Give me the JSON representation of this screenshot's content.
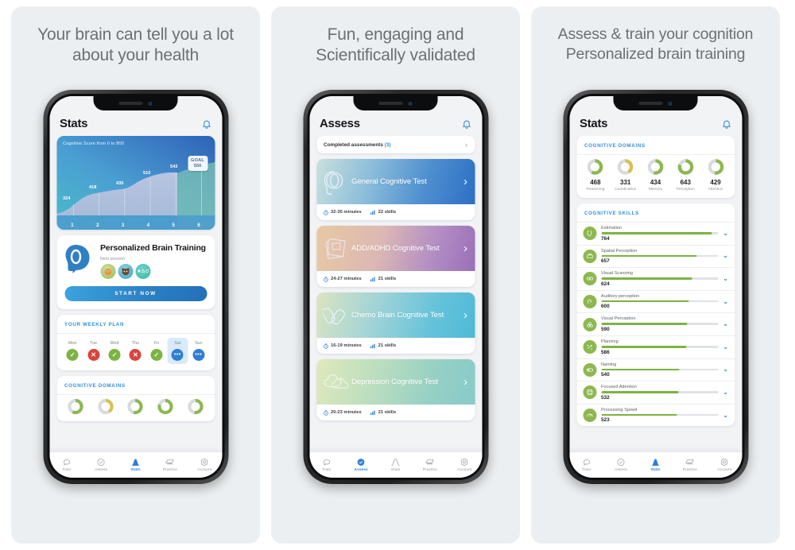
{
  "panels": [
    {
      "headline": "Your brain can tell you a lot\nabout your health",
      "headline_l1": "Your brain can tell you a lot",
      "headline_l2": "about your health",
      "screen": {
        "title": "Stats",
        "bell": "bell-icon",
        "chart_caption": "Cognitive Score from 0 to 800",
        "goal_label": "GOAL",
        "goal_value": "550",
        "pbt": {
          "title": "Personalized Brain Training",
          "next_session": "Next session:",
          "start_label": "START NOW",
          "avatars": [
            "orange-creature",
            "brown-creature",
            "shapes-icon"
          ]
        },
        "weekly": {
          "heading": "YOUR WEEKLY PLAN",
          "days": [
            {
              "label": "Mon",
              "state": "ok",
              "glyph": "✓"
            },
            {
              "label": "Tue",
              "state": "no",
              "glyph": "✕"
            },
            {
              "label": "Wed",
              "state": "ok",
              "glyph": "✓"
            },
            {
              "label": "Thu",
              "state": "no",
              "glyph": "✕"
            },
            {
              "label": "Fri",
              "state": "ok",
              "glyph": "✓"
            },
            {
              "label": "Sat",
              "state": "pend",
              "glyph": "•••",
              "highlight": true
            },
            {
              "label": "Sun",
              "state": "pend",
              "glyph": "•••"
            }
          ]
        },
        "domains_heading": "COGNITIVE DOMAINS",
        "tabs": [
          {
            "label": "Train",
            "icon": "brain-outline-icon",
            "active": false
          },
          {
            "label": "Assess",
            "icon": "check-circle-icon",
            "active": false
          },
          {
            "label": "Stats",
            "icon": "bell-curve-icon",
            "active": true
          },
          {
            "label": "Practice",
            "icon": "card-stack-icon",
            "active": false
          },
          {
            "label": "Account",
            "icon": "gear-hex-icon",
            "active": false
          }
        ]
      }
    },
    {
      "headline_l1": "Fun, engaging and",
      "headline_l2": "Scientifically validated",
      "screen": {
        "title": "Assess",
        "completed_label": "Completed assessments",
        "completed_count": "(3)",
        "cards": [
          {
            "name": "General Cognitive Test",
            "duration": "32-35 minutes",
            "skills": "22 skills",
            "icon": "head-brain-icon",
            "grad": "linear-gradient(105deg,#c7e0dc 0%,#8fbfdb 32%,#4e8fd0 68%,#2d6fc4 100%)"
          },
          {
            "name": "ADD/ADHD Cognitive Test",
            "duration": "24-27 minutes",
            "skills": "21 skills",
            "icon": "notebook-icon",
            "grad": "linear-gradient(105deg,#e8c9a2 0%,#dcb8b4 40%,#b38fc4 72%,#9a6fb8 100%)"
          },
          {
            "name": "Chemo Brain Cognitive Test",
            "duration": "16-19 minutes",
            "skills": "21 skills",
            "icon": "pills-icon",
            "grad": "linear-gradient(105deg,#dbe4c0 0%,#9fd3d8 38%,#66c3da 72%,#4fb9d6 100%)"
          },
          {
            "name": "Depression Cognitive Test",
            "duration": "20-23 minutes",
            "skills": "21 skills",
            "icon": "clouds-icon",
            "grad": "linear-gradient(105deg,#dfe9bc 0%,#b8ddbf 40%,#96d0c5 72%,#88cbc9 100%)"
          }
        ],
        "tabs": [
          {
            "label": "Train",
            "icon": "brain-outline-icon",
            "active": false
          },
          {
            "label": "Assess",
            "icon": "check-circle-icon",
            "active": true
          },
          {
            "label": "Stats",
            "icon": "bell-curve-icon",
            "active": false
          },
          {
            "label": "Practice",
            "icon": "card-stack-icon",
            "active": false
          },
          {
            "label": "Account",
            "icon": "gear-hex-icon",
            "active": false
          }
        ]
      }
    },
    {
      "headline_l1": "Assess & train your cognition",
      "headline_l2": "Personalized brain training",
      "screen": {
        "title": "Stats",
        "domains_heading": "COGNITIVE DOMAINS",
        "domains": [
          {
            "name": "Reasoning",
            "value": "468",
            "pct": 58,
            "color": "#8cb84f"
          },
          {
            "name": "Coordination",
            "value": "331",
            "pct": 41,
            "color": "#d2c255"
          },
          {
            "name": "Memory",
            "value": "434",
            "pct": 54,
            "color": "#8cb84f"
          },
          {
            "name": "Perception",
            "value": "643",
            "pct": 80,
            "color": "#8cb84f"
          },
          {
            "name": "Attention",
            "value": "429",
            "pct": 53,
            "color": "#8cb84f"
          }
        ],
        "skills_heading": "COGNITIVE SKILLS",
        "skills": [
          {
            "name": "Estimation",
            "value": "764",
            "pct": 95,
            "icon": "estimation-icon"
          },
          {
            "name": "Spatial Perception",
            "value": "657",
            "pct": 82,
            "icon": "spatial-perception-icon"
          },
          {
            "name": "Visual Scanning",
            "value": "624",
            "pct": 78,
            "icon": "visual-scanning-icon"
          },
          {
            "name": "Auditory perception",
            "value": "600",
            "pct": 75,
            "icon": "auditory-perception-icon"
          },
          {
            "name": "Visual Perception",
            "value": "590",
            "pct": 74,
            "icon": "visual-perception-icon"
          },
          {
            "name": "Planning",
            "value": "586",
            "pct": 73,
            "icon": "planning-icon"
          },
          {
            "name": "Naming",
            "value": "540",
            "pct": 67,
            "icon": "naming-icon"
          },
          {
            "name": "Focused Attention",
            "value": "532",
            "pct": 66,
            "icon": "focused-attention-icon"
          },
          {
            "name": "Processing Speed",
            "value": "523",
            "pct": 65,
            "icon": "processing-speed-icon"
          }
        ],
        "tabs": [
          {
            "label": "Train",
            "icon": "brain-outline-icon",
            "active": false
          },
          {
            "label": "Assess",
            "icon": "check-circle-icon",
            "active": false
          },
          {
            "label": "Stats",
            "icon": "bell-curve-icon",
            "active": true
          },
          {
            "label": "Practice",
            "icon": "card-stack-icon",
            "active": false
          },
          {
            "label": "Account",
            "icon": "gear-hex-icon",
            "active": false
          }
        ]
      }
    }
  ],
  "chart_data": {
    "type": "area",
    "title": "Cognitive Score from 0 to 800",
    "categories": [
      "1",
      "2",
      "3",
      "4",
      "5",
      "6"
    ],
    "values": [
      324,
      418,
      435,
      510,
      543,
      null
    ],
    "point_labels": [
      "324",
      "418",
      "435",
      "510",
      "543"
    ],
    "goal": 550,
    "goal_label": "GOAL",
    "ylim": [
      0,
      800
    ],
    "xlabel": "",
    "ylabel": "",
    "grid": true,
    "legend": "none"
  },
  "colors": {
    "panel_bg": "#eceff1",
    "screen_bg": "#f2f3f5",
    "accent_blue": "#2f8fe0",
    "green": "#7cb342",
    "red": "#d8453e",
    "yellow": "#d2c255"
  }
}
